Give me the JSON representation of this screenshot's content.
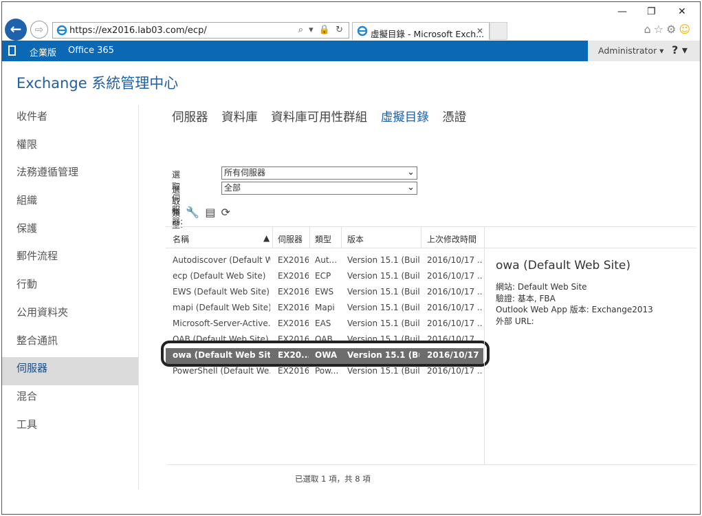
{
  "browser": {
    "url": "https://ex2016.lab03.com/ecp/",
    "tab_title": "虛擬目錄 - Microsoft Exch...",
    "tab_close": "✕",
    "addr_tools": "⌕ ▾ 🔒 ↻",
    "win_min": "—",
    "win_restore": "❐",
    "win_close": "✕",
    "icon_home": "⌂",
    "icon_star": "☆",
    "icon_gear": "⚙",
    "icon_smile": "☺"
  },
  "office_bar": {
    "edition": "企業版",
    "brand": "Office 365",
    "user": "Administrator ▾",
    "help": "? ▾"
  },
  "app": {
    "title": "Exchange 系統管理中心"
  },
  "nav": {
    "items": [
      {
        "label": "收件者"
      },
      {
        "label": "權限"
      },
      {
        "label": "法務遵循管理"
      },
      {
        "label": "組織"
      },
      {
        "label": "保護"
      },
      {
        "label": "郵件流程"
      },
      {
        "label": "行動"
      },
      {
        "label": "公用資料夾"
      },
      {
        "label": "整合通訊"
      },
      {
        "label": "伺服器"
      },
      {
        "label": "混合"
      },
      {
        "label": "工具"
      }
    ],
    "active_index": 9
  },
  "subtabs": [
    "伺服器",
    "資料庫",
    "資料庫可用性群組",
    "虛擬目錄",
    "憑證"
  ],
  "filters": {
    "server_label": "選取伺服器:",
    "server_value": "所有伺服器",
    "type_label": "選取類型:",
    "type_value": "全部"
  },
  "toolbar": {
    "edit": "✎",
    "configure": "🔧",
    "reset": "▤",
    "refresh": "⟳"
  },
  "grid": {
    "headers": [
      "名稱",
      "伺服器",
      "類型",
      "版本",
      "上次修改時間"
    ],
    "sort_indicator": "▲",
    "rows": [
      {
        "name": "Autodiscover (Default W...",
        "server": "EX2016",
        "type": "Aut...",
        "version": "Version 15.1 (Buil...",
        "modified": "2016/10/17 ..."
      },
      {
        "name": "ecp (Default Web Site)",
        "server": "EX2016",
        "type": "ECP",
        "version": "Version 15.1 (Buil...",
        "modified": "2016/10/17 ..."
      },
      {
        "name": "EWS (Default Web Site)",
        "server": "EX2016",
        "type": "EWS",
        "version": "Version 15.1 (Buil...",
        "modified": "2016/10/17 ..."
      },
      {
        "name": "mapi (Default Web Site)",
        "server": "EX2016",
        "type": "Mapi",
        "version": "Version 15.1 (Buil...",
        "modified": "2016/10/17 ..."
      },
      {
        "name": "Microsoft-Server-Active...",
        "server": "EX2016",
        "type": "EAS",
        "version": "Version 15.1 (Buil...",
        "modified": "2016/10/17 ..."
      },
      {
        "name": "OAB (Default Web Site)",
        "server": "EX2016",
        "type": "OAB",
        "version": "Version 15.1 (Buil...",
        "modified": "2016/10/17 ..."
      },
      {
        "name": "owa (Default Web Site)",
        "server": "EX20...",
        "type": "OWA",
        "version": "Version 15.1 (Bui...",
        "modified": "2016/10/17 ..."
      },
      {
        "name": "PowerShell (Default We...",
        "server": "EX2016",
        "type": "Pow...",
        "version": "Version 15.1 (Buil...",
        "modified": "2016/10/17 ..."
      }
    ],
    "selected_index": 6
  },
  "detail": {
    "title": "owa (Default Web Site)",
    "site": "網站: Default Web Site",
    "auth": "驗證: 基本, FBA",
    "owa_version": "Outlook Web App 版本: Exchange2013",
    "external_url": "外部 URL:"
  },
  "status": "已選取 1 項，共 8 項"
}
